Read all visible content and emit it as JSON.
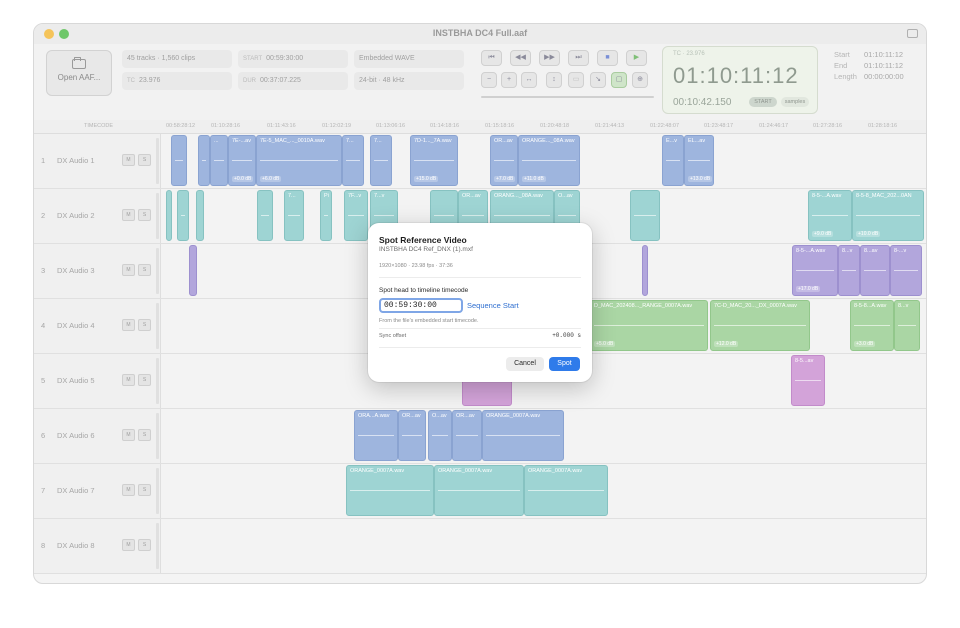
{
  "window": {
    "title": "INSTBHA DC4 Full.aaf",
    "colors": {
      "close": "#f5c45a",
      "min": "#6fc76a"
    }
  },
  "toolbar": {
    "open_label": "Open AAF...",
    "tracks_clips": "45 tracks · 1,560 clips",
    "tc_key": "TC",
    "tc_rate": "23.976",
    "start_key": "START",
    "start_val": "00:59:30:00",
    "dur_key": "DUR",
    "dur_val": "00:37:07.225",
    "media_type": "Embedded WAVE",
    "audio_fmt": "24-bit · 48 kHz"
  },
  "transport": {
    "row1": [
      "⏮",
      "◀◀",
      "▶▶",
      "⏭",
      "■",
      "▶"
    ],
    "row2": [
      "−",
      "+",
      "↔",
      "↕",
      "▭",
      "↘",
      "▢",
      "⊕"
    ]
  },
  "timecode": {
    "fps_label": "TC · 23.976",
    "main": "01:10:11:12",
    "secondary": "00:10:42.150",
    "pill1": "START",
    "pill2": "samples"
  },
  "meta": {
    "start_label": "Start",
    "start_val": "01:10:11:12",
    "end_label": "End",
    "end_val": "01:10:11:12",
    "length_label": "Length",
    "length_val": "00:00:00:00"
  },
  "ruler": {
    "label": "TIMECODE",
    "ticks": [
      "00:58:28:12",
      "01:10:28:16",
      "01:11:43:16",
      "01:12:02:19",
      "01:13:06:16",
      "01:14:18:16",
      "01:15:18:16",
      "01:20:48:18",
      "01:21:44:13",
      "01:22:48:07",
      "01:23:48:17",
      "01:24:46:17",
      "01:27:28:16",
      "01:28:18:16"
    ]
  },
  "tracks": [
    {
      "num": "1",
      "name": "DX Audio 1"
    },
    {
      "num": "2",
      "name": "DX Audio 2"
    },
    {
      "num": "3",
      "name": "DX Audio 3"
    },
    {
      "num": "4",
      "name": "DX Audio 4"
    },
    {
      "num": "5",
      "name": "DX Audio 5"
    },
    {
      "num": "6",
      "name": "DX Audio 6"
    },
    {
      "num": "7",
      "name": "DX Audio 7"
    },
    {
      "num": "8",
      "name": "DX Audio 8"
    }
  ],
  "clips": {
    "t1": [
      "...",
      "7E-...av",
      "7E-5_MAC_..._0010A.wav",
      "7...",
      "7...",
      "7D-1..._7A.wav",
      "OR...av",
      "ORANGE..._08A.wav",
      "E...v",
      "EL...av"
    ],
    "t2": [
      "7...",
      "7...",
      "Pi",
      "7F...v",
      "7...v",
      "OR...av",
      "ORANG..._08A.wav",
      "O...av",
      "8-5-...A.wav",
      "8-5-8_MAC_202...0AN"
    ],
    "t3": [
      "8-5-...A.wav",
      "8...v",
      "8...av",
      "8-...v"
    ],
    "t4": [
      "D_MAC_202408..._RANGE_0007A.wav",
      "7C-D_MAC_20..._DX_0007A.wav",
      "8-5-8...A.wav",
      "8...v"
    ],
    "t5": [
      "8-5...av"
    ],
    "t6": [
      "ORA...A.wav",
      "OR...av",
      "O...av",
      "OR...av",
      "ORANGE_0007A.wav"
    ],
    "t7": [
      "ORANGE_0007A.wav",
      "ORANGE_0007A.wav",
      "ORANGE_0007A.wav"
    ],
    "gains": [
      "+0.0 dB",
      "+6.0 dB",
      "+15.0 dB",
      "+7.0 dB",
      "+11.0 dB",
      "+13.0 dB",
      "+9.0 dB",
      "+10.0 dB",
      "+17.0 dB",
      "+5.0 dB",
      "+12.0 dB",
      "+3.0 dB"
    ]
  },
  "dialog": {
    "title": "Spot Reference Video",
    "file": "INSTBHA DC4 Ref_DNX (1).mxf",
    "meta": "1920×1080 · 23.98 fps · 37:36",
    "field_label": "Spot head to timeline timecode",
    "field_value": "00:59:30:00",
    "link": "Sequence Start",
    "hint": "From the file's embedded start timecode.",
    "sync_label": "Sync offset",
    "sync_value": "+0.000 s",
    "cancel": "Cancel",
    "spot": "Spot"
  }
}
